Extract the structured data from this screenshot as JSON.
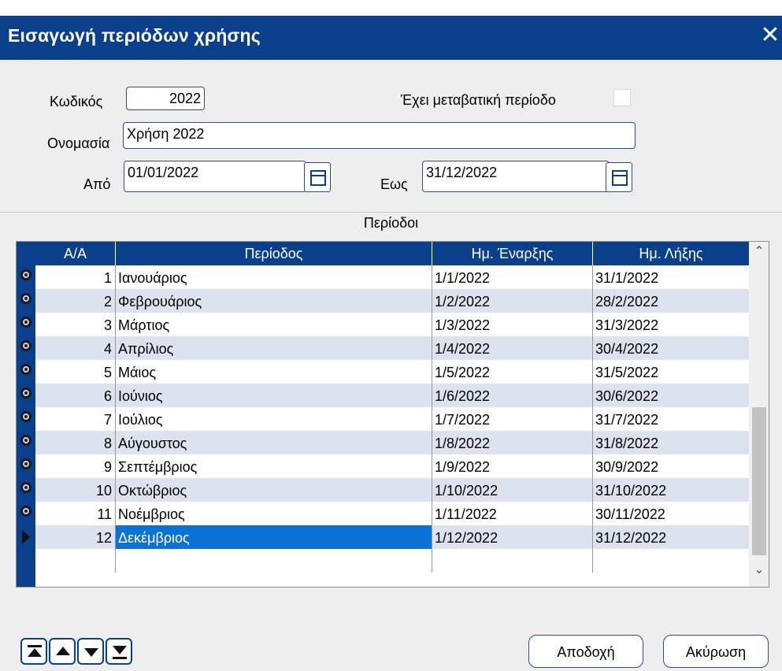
{
  "window": {
    "title": "Εισαγωγή περιόδων χρήσης",
    "close_label": "✕"
  },
  "form": {
    "code_label": "Κωδικός",
    "code_value": "2022",
    "transition_label": "Έχει μεταβατική περίοδο",
    "transition_checked": false,
    "name_label": "Ονομασία",
    "name_value": "Χρήση 2022",
    "from_label": "Από",
    "from_value": "01/01/2022",
    "to_label": "Εως",
    "to_value": "31/12/2022"
  },
  "grid": {
    "title": "Περίοδοι",
    "columns": [
      "Α/Α",
      "Περίοδος",
      "Ημ. Έναρξης",
      "Ημ. Λήξης"
    ],
    "rows": [
      {
        "aa": "1",
        "period": "Ιανουάριος",
        "start": "1/1/2022",
        "end": "31/1/2022"
      },
      {
        "aa": "2",
        "period": "Φεβρουάριος",
        "start": "1/2/2022",
        "end": "28/2/2022"
      },
      {
        "aa": "3",
        "period": "Μάρτιος",
        "start": "1/3/2022",
        "end": "31/3/2022"
      },
      {
        "aa": "4",
        "period": "Απρίλιος",
        "start": "1/4/2022",
        "end": "30/4/2022"
      },
      {
        "aa": "5",
        "period": "Μάιος",
        "start": "1/5/2022",
        "end": "31/5/2022"
      },
      {
        "aa": "6",
        "period": "Ιούνιος",
        "start": "1/6/2022",
        "end": "30/6/2022"
      },
      {
        "aa": "7",
        "period": "Ιούλιος",
        "start": "1/7/2022",
        "end": "31/7/2022"
      },
      {
        "aa": "8",
        "period": "Αύγουστος",
        "start": "1/8/2022",
        "end": "31/8/2022"
      },
      {
        "aa": "9",
        "period": "Σεπτέμβριος",
        "start": "1/9/2022",
        "end": "30/9/2022"
      },
      {
        "aa": "10",
        "period": "Οκτώβριος",
        "start": "1/10/2022",
        "end": "31/10/2022"
      },
      {
        "aa": "11",
        "period": "Νοέμβριος",
        "start": "1/11/2022",
        "end": "30/11/2022"
      },
      {
        "aa": "12",
        "period": "Δεκέμβριος",
        "start": "1/12/2022",
        "end": "31/12/2022"
      }
    ],
    "selected_index": 11
  },
  "footer": {
    "accept_label": "Αποδοχή",
    "cancel_label": "Ακύρωση"
  },
  "colors": {
    "title_bar": "#0a3f8c",
    "selection": "#0a72d6",
    "alt_row": "#dde3ee"
  },
  "icons": {
    "close": "close-icon",
    "calendar": "calendar-icon",
    "nav": [
      "first-record-icon",
      "previous-record-icon",
      "next-record-icon",
      "last-record-icon"
    ]
  }
}
